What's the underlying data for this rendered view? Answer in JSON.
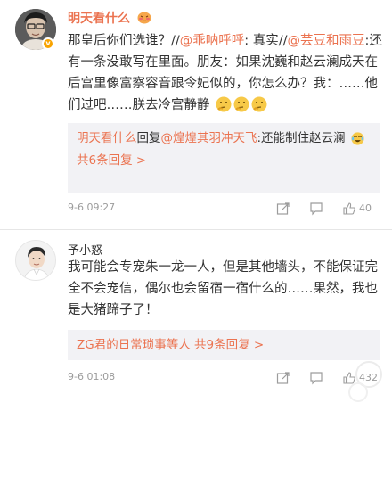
{
  "comments": [
    {
      "username": "明天看什么",
      "verified": true,
      "text_parts": [
        {
          "t": "那皇后你们选谁？//",
          "m": false
        },
        {
          "t": "@乖呐呼呼",
          "m": true
        },
        {
          "t": ": 真实//",
          "m": false
        },
        {
          "t": "@芸豆和雨豆",
          "m": true
        },
        {
          "t": ":还有一条没敢写在里面。朋友：如果沈巍和赵云澜成天在后宫里像富察容音跟令妃似的，你怎么办？我：……他们过吧……朕去冷宫静静",
          "m": false
        }
      ],
      "reply": {
        "name": "明天看什么",
        "action": "回复",
        "target": "@煌煌其羽冲天飞",
        "text": ":还能制住赵云澜",
        "more": "共6条回复 >"
      },
      "time": "9-6 09:27",
      "like_count": "40"
    },
    {
      "username": "予小怒",
      "text": "我可能会专宠朱一龙一人，但是其他墙头，不能保证完全不会宠信，偶尔也会留宿一宿什么的……果然，我也是大猪蹄子了！",
      "reply": {
        "name": "ZG君的日常琐事等人",
        "more": "共9条回复 >"
      },
      "time": "9-6 01:08",
      "like_count": "432"
    }
  ],
  "icons": {
    "share": "share-icon",
    "comment": "comment-icon",
    "like": "thumbs-up-icon",
    "verified": "verified-badge-icon"
  },
  "colors": {
    "accent": "#eb7350",
    "text": "#333333",
    "muted": "#9c9c9c",
    "reply_bg": "#f2f2f5"
  }
}
